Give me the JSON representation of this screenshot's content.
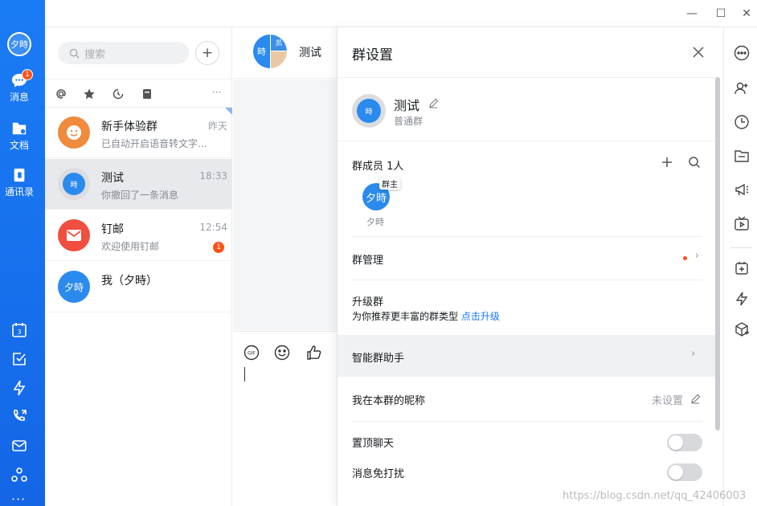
{
  "window": {
    "controls": {
      "minimize": "—",
      "maximize": "☐",
      "close": "✕"
    }
  },
  "nav": {
    "avatar_text": "夕時",
    "items": [
      {
        "label": "消息",
        "icon": "message-icon",
        "badge": "1"
      },
      {
        "label": "文档",
        "icon": "docs-icon"
      },
      {
        "label": "通讯录",
        "icon": "contacts-icon"
      }
    ],
    "more": "···"
  },
  "conversation_list": {
    "search_placeholder": "搜索",
    "add_symbol": "+",
    "filter_more": "···",
    "conversations": [
      {
        "name": "新手体验群",
        "preview": "已自动开启语音转文字...",
        "time": "昨天",
        "avatar_color": "#f08a3c"
      },
      {
        "name": "测试",
        "preview": "你撤回了一条消息",
        "time": "18:33",
        "avatar_text": "時",
        "active": true
      },
      {
        "name": "钉邮",
        "preview": "欢迎使用钉邮",
        "time": "12:54",
        "badge": "1",
        "avatar_color": "#f04e3e"
      },
      {
        "name": "我（夕時）",
        "preview": "",
        "time": "",
        "avatar_text": "夕時",
        "avatar_color": "#2b8aee"
      }
    ]
  },
  "chat": {
    "title": "测试",
    "avatar_left": "時",
    "avatar_right": "凯",
    "tool_gif": "GIF"
  },
  "group_settings": {
    "title": "群设置",
    "group_name": "测试",
    "group_type": "普通群",
    "group_avatar_text": "時",
    "members_label": "群成员 1人",
    "member": {
      "avatar_text": "夕時",
      "name": "夕時",
      "role_badge": "群主"
    },
    "manage_label": "群管理",
    "upgrade_label": "升级群",
    "upgrade_desc": "为你推荐更丰富的群类型",
    "upgrade_link": "点击升级",
    "assistant_label": "智能群助手",
    "nickname_label": "我在本群的昵称",
    "nickname_value": "未设置",
    "pin_label": "置顶聊天",
    "mute_label": "消息免打扰",
    "chevron": "›"
  },
  "watermark": "https://blog.csdn.net/qq_42406003"
}
